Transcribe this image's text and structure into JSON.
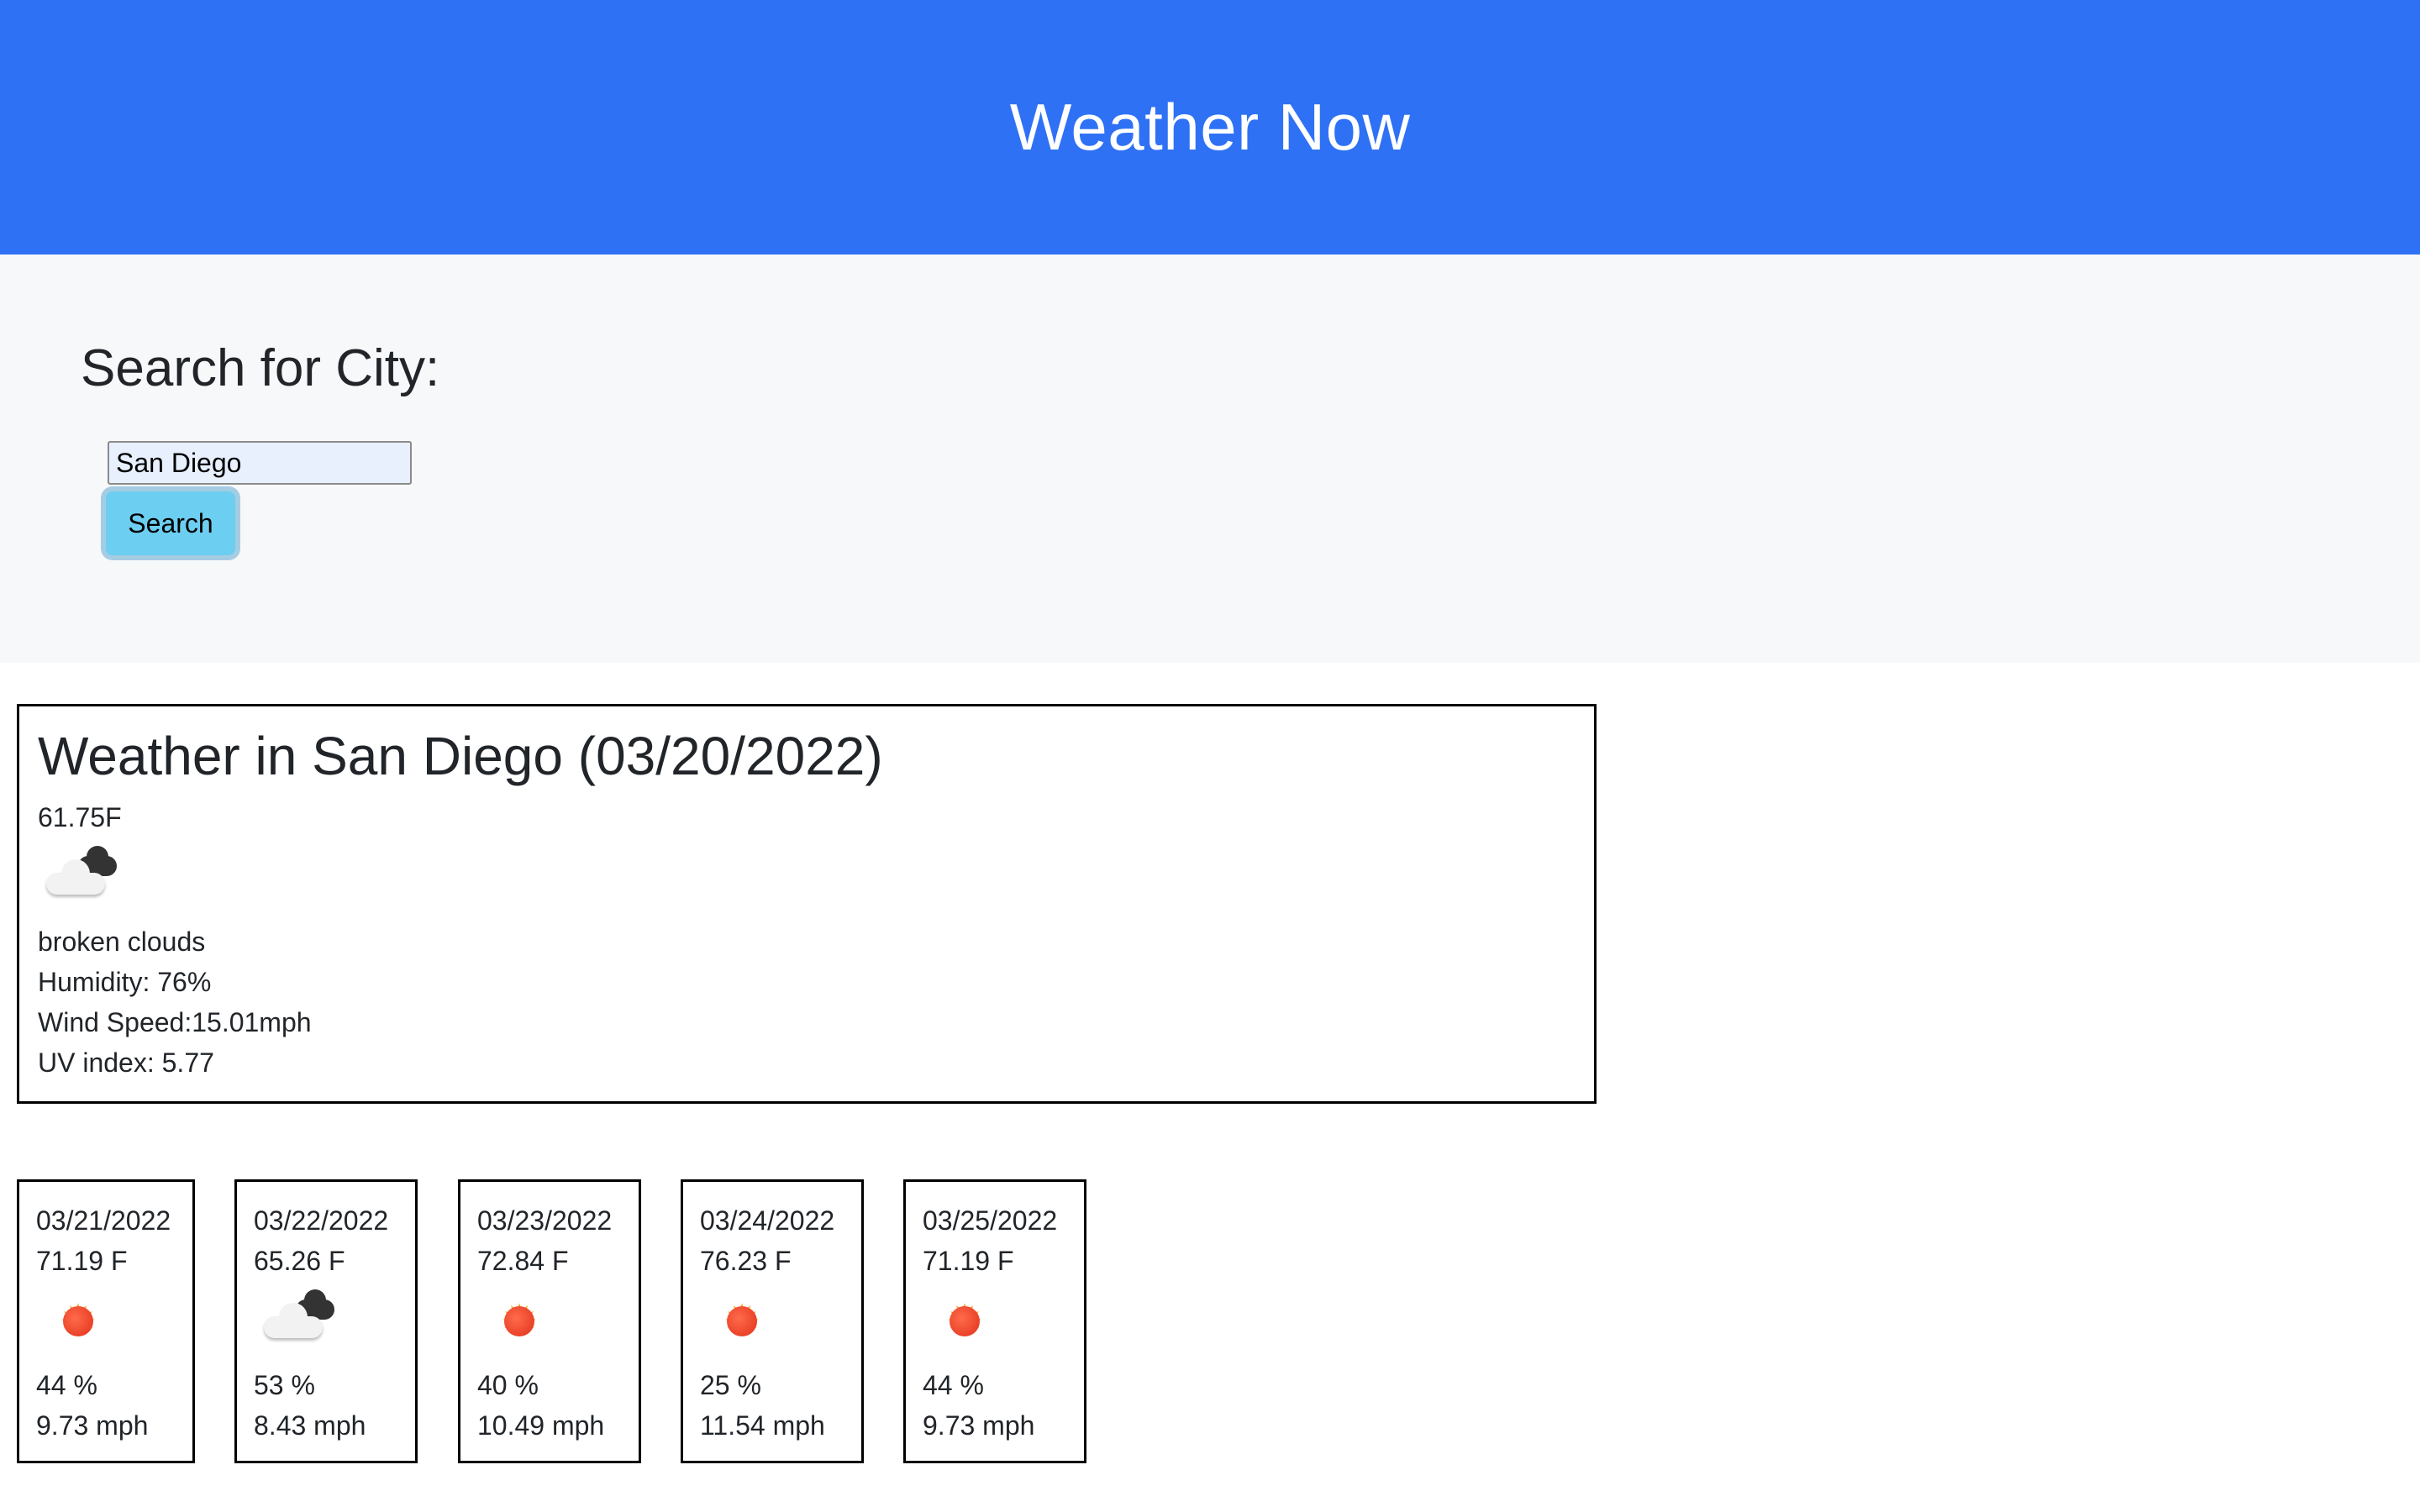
{
  "header": {
    "title": "Weather Now"
  },
  "search": {
    "title": "Search for City:",
    "input_value": "San Diego",
    "button_label": "Search"
  },
  "current": {
    "title": "Weather in San Diego (03/20/2022)",
    "temperature": "61.75F",
    "icon": "broken-clouds-icon",
    "description": "broken clouds",
    "humidity": "Humidity: 76%",
    "wind": "Wind Speed:15.01mph",
    "uv": "UV index: 5.77"
  },
  "forecast": [
    {
      "date": "03/21/2022",
      "temp": "71.19 F",
      "icon": "sun-icon",
      "humidity": "44 %",
      "wind": "9.73 mph"
    },
    {
      "date": "03/22/2022",
      "temp": "65.26 F",
      "icon": "broken-clouds-icon",
      "humidity": "53 %",
      "wind": "8.43 mph"
    },
    {
      "date": "03/23/2022",
      "temp": "72.84 F",
      "icon": "sun-icon",
      "humidity": "40 %",
      "wind": "10.49 mph"
    },
    {
      "date": "03/24/2022",
      "temp": "76.23 F",
      "icon": "sun-icon",
      "humidity": "25 %",
      "wind": "11.54 mph"
    },
    {
      "date": "03/25/2022",
      "temp": "71.19 F",
      "icon": "sun-icon",
      "humidity": "44 %",
      "wind": "9.73 mph"
    }
  ],
  "colors": {
    "header_bg": "#2e71f5",
    "search_bg": "#f7f8f9",
    "button_bg": "#6ccef0"
  }
}
